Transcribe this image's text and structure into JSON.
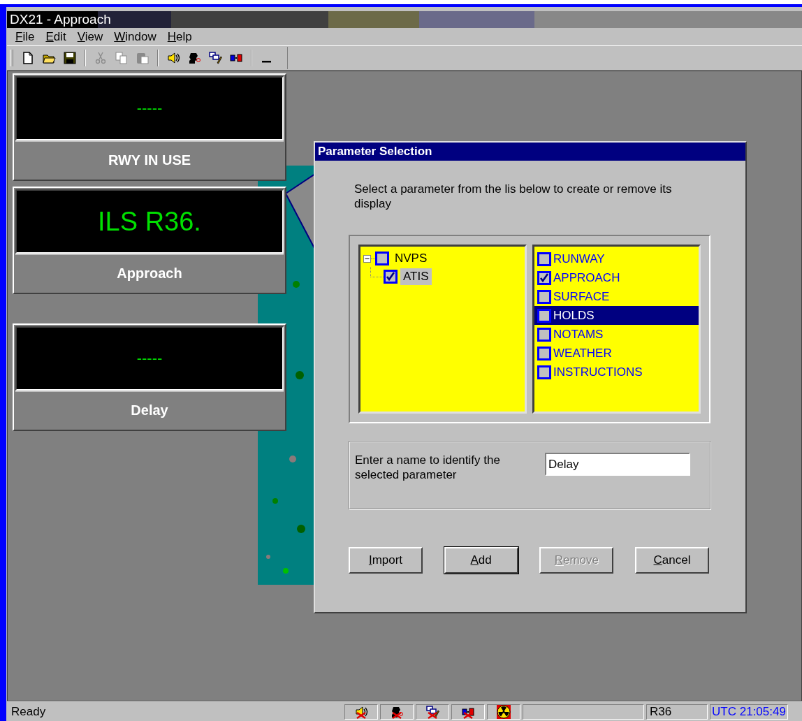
{
  "window": {
    "title": "DX21 - Approach"
  },
  "menu": [
    {
      "label": "File"
    },
    {
      "label": "Edit"
    },
    {
      "label": "View"
    },
    {
      "label": "Window"
    },
    {
      "label": "Help"
    }
  ],
  "toolbar": [
    {
      "kind": "new",
      "disabled": false
    },
    {
      "kind": "open",
      "disabled": false
    },
    {
      "kind": "save",
      "disabled": false
    },
    {
      "kind": "separator"
    },
    {
      "kind": "cut",
      "disabled": true
    },
    {
      "kind": "copy",
      "disabled": true
    },
    {
      "kind": "paste",
      "disabled": true
    },
    {
      "kind": "separator"
    },
    {
      "kind": "speaker",
      "disabled": false
    },
    {
      "kind": "person",
      "disabled": false
    },
    {
      "kind": "windows",
      "disabled": false
    },
    {
      "kind": "connect",
      "disabled": false
    },
    {
      "kind": "separator"
    },
    {
      "kind": "dash",
      "disabled": false
    }
  ],
  "displays": [
    {
      "value": "-----",
      "label": "RWY IN USE",
      "kind": "empty"
    },
    {
      "value": "ILS R36.",
      "label": "Approach",
      "kind": "value"
    },
    {
      "value": "-----",
      "label": "Delay",
      "kind": "empty"
    }
  ],
  "dialog": {
    "title": "Parameter Selection",
    "prompt": "Select a parameter from the lis below to create or remove its display",
    "tree": [
      {
        "label": "NVPS",
        "checked": false,
        "expanded": true,
        "selected": false,
        "children": [
          {
            "label": "ATIS",
            "checked": true,
            "selected": true
          }
        ]
      }
    ],
    "parameters": [
      {
        "label": "RUNWAY",
        "checked": false,
        "selected": false
      },
      {
        "label": "APPROACH",
        "checked": true,
        "selected": false
      },
      {
        "label": "SURFACE",
        "checked": false,
        "selected": false
      },
      {
        "label": "HOLDS",
        "checked": false,
        "selected": true
      },
      {
        "label": "NOTAMS",
        "checked": false,
        "selected": false
      },
      {
        "label": "WEATHER",
        "checked": false,
        "selected": false
      },
      {
        "label": "INSTRUCTIONS",
        "checked": false,
        "selected": false
      }
    ],
    "name_label": "Enter a name to identify the selected parameter",
    "name_value": "Delay",
    "buttons": [
      {
        "label": "Import",
        "disabled": false,
        "default": false
      },
      {
        "label": "Add",
        "disabled": false,
        "default": true
      },
      {
        "label": "Remove",
        "disabled": true,
        "default": false
      },
      {
        "label": "Cancel",
        "disabled": false,
        "default": false
      }
    ]
  },
  "status_bar": {
    "text": "Ready",
    "icons": [
      {
        "kind": "speaker",
        "crossed": true
      },
      {
        "kind": "person",
        "crossed": true
      },
      {
        "kind": "windows",
        "crossed": true
      },
      {
        "kind": "connect",
        "crossed": true
      },
      {
        "kind": "radiation",
        "crossed": false
      }
    ],
    "runway": "R36",
    "clock": "UTC 21:05:49"
  }
}
